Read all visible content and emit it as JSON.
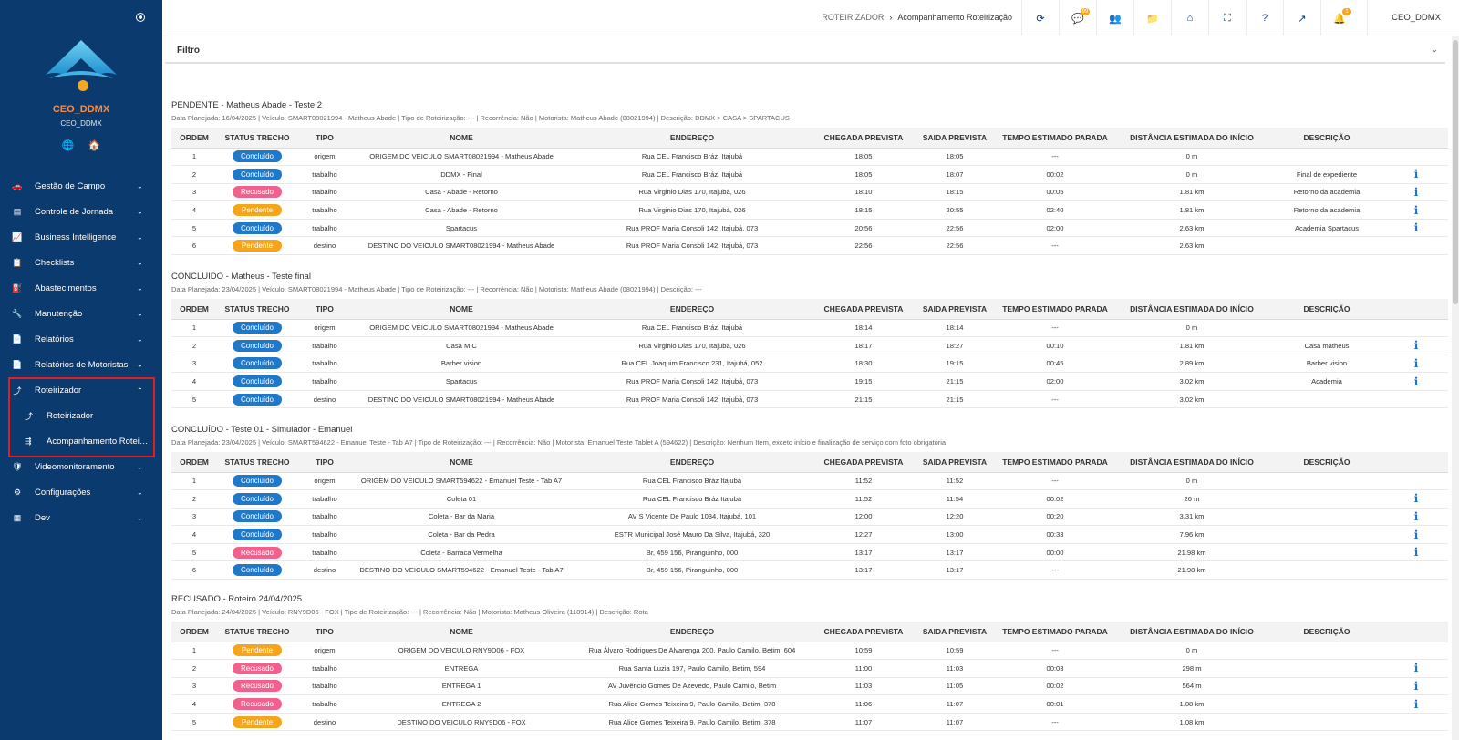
{
  "colors": {
    "sidebar": "#0b3a6e",
    "concluido": "#1f78c8",
    "recusado": "#f2608e",
    "pendente": "#f6a51b",
    "info": "#1a73c8",
    "highlight": "#e02020"
  },
  "sidebar": {
    "user": "CEO_DDMX",
    "user_sub": "CEO_DDMX",
    "items": [
      {
        "icon": "car-icon",
        "glyph": "🚗",
        "label": "Gestão de Campo"
      },
      {
        "icon": "clock-card-icon",
        "glyph": "▤",
        "label": "Controle de Jornada"
      },
      {
        "icon": "chart-line-icon",
        "glyph": "📈",
        "label": "Business Intelligence"
      },
      {
        "icon": "clipboard-icon",
        "glyph": "📋",
        "label": "Checklists"
      },
      {
        "icon": "fuel-icon",
        "glyph": "⛽",
        "label": "Abastecimentos"
      },
      {
        "icon": "wrench-icon",
        "glyph": "🔧",
        "label": "Manutenção"
      },
      {
        "icon": "file-icon",
        "glyph": "📄",
        "label": "Relatórios"
      },
      {
        "icon": "file-icon",
        "glyph": "📄",
        "label": "Relatórios de Motoristas"
      },
      {
        "icon": "route-icon",
        "glyph": "⤴",
        "label": "Roteirizador"
      }
    ],
    "subitems": [
      {
        "icon": "route-icon",
        "glyph": "⤴",
        "label": "Roteirizador"
      },
      {
        "icon": "route-split-icon",
        "glyph": "⇶",
        "label": "Acompanhamento Roteirização"
      }
    ],
    "items_after": [
      {
        "icon": "shield-icon",
        "glyph": "🛡",
        "label": "Videomonitoramento"
      },
      {
        "icon": "gears-icon",
        "glyph": "⚙",
        "label": "Configurações"
      },
      {
        "icon": "dev-icon",
        "glyph": "▦",
        "label": "Dev"
      }
    ]
  },
  "topbar": {
    "breadcrumb_root": "ROTEIRIZADOR",
    "breadcrumb_current": "Acompanhamento Roteirização",
    "buttons": [
      {
        "icon": "refresh-icon",
        "glyph": "⟳",
        "badge": ""
      },
      {
        "icon": "chat-icon",
        "glyph": "💬",
        "badge": "99"
      },
      {
        "icon": "users-icon",
        "glyph": "👥",
        "badge": ""
      },
      {
        "icon": "folder-icon",
        "glyph": "📁",
        "badge": ""
      },
      {
        "icon": "home-icon",
        "glyph": "⌂",
        "badge": ""
      },
      {
        "icon": "fullscreen-icon",
        "glyph": "⛶",
        "badge": ""
      },
      {
        "icon": "help-icon",
        "glyph": "?",
        "badge": ""
      },
      {
        "icon": "external-link-icon",
        "glyph": "↗",
        "badge": ""
      },
      {
        "icon": "bell-icon",
        "glyph": "🔔",
        "badge": "1"
      }
    ],
    "user": "CEO_DDMX"
  },
  "filter": {
    "title": "Filtro"
  },
  "sections": [
    {
      "title": "PENDENTE - Matheus Abade - Teste 2",
      "meta": "Data Planejada: 16/04/2025 | Veículo: SMART08021994 - Matheus Abade | Tipo de Roteirização: --- | Recorrência: Não | Motorista: Matheus Abade (08021994) | Descrição: DDMX > CASA > SPARTACUS",
      "headers": [
        "ORDEM",
        "STATUS TRECHO",
        "TIPO",
        "NOME",
        "ENDEREÇO",
        "CHEGADA PREVISTA",
        "SAIDA PREVISTA",
        "TEMPO ESTIMADO PARADA",
        "DISTÂNCIA ESTIMADA DO INÍCIO",
        "DESCRIÇÃO",
        ""
      ],
      "rows": [
        [
          "1",
          "Concluído",
          "origem",
          "ORIGEM DO VEICULO SMART08021994 - Matheus Abade",
          "Rua CEL Francisco Bráz, Itajubá",
          "18:05",
          "18:05",
          "---",
          "0 m",
          "",
          ""
        ],
        [
          "2",
          "Concluído",
          "trabalho",
          "DDMX - Final",
          "Rua CEL Francisco Bráz, Itajubá",
          "18:05",
          "18:07",
          "00:02",
          "0 m",
          "Final de expediente",
          "i"
        ],
        [
          "3",
          "Recusado",
          "trabalho",
          "Casa - Abade - Retorno",
          "Rua Virginio Dias 170, Itajubá, 026",
          "18:10",
          "18:15",
          "00:05",
          "1.81 km",
          "Retorno da academia",
          "i"
        ],
        [
          "4",
          "Pendente",
          "trabalho",
          "Casa - Abade - Retorno",
          "Rua Virginio Dias 170, Itajubá, 026",
          "18:15",
          "20:55",
          "02:40",
          "1.81 km",
          "Retorno da academia",
          "i"
        ],
        [
          "5",
          "Concluído",
          "trabalho",
          "Spartacus",
          "Rua PROF Maria Consoli 142, Itajubá, 073",
          "20:56",
          "22:56",
          "02:00",
          "2.63 km",
          "Academia Spartacus",
          "i"
        ],
        [
          "6",
          "Pendente",
          "destino",
          "DESTINO DO VEICULO SMART08021994 - Matheus Abade",
          "Rua PROF Maria Consoli 142, Itajubá, 073",
          "22:56",
          "22:56",
          "---",
          "2.63 km",
          "",
          ""
        ]
      ]
    },
    {
      "title": "CONCLUÍDO - Matheus - Teste final",
      "meta": "Data Planejada: 23/04/2025 | Veículo: SMART08021994 - Matheus Abade | Tipo de Roteirização: --- | Recorrência: Não | Motorista: Matheus Abade (08021994) | Descrição: ---",
      "headers": [
        "ORDEM",
        "STATUS TRECHO",
        "TIPO",
        "NOME",
        "ENDEREÇO",
        "CHEGADA PREVISTA",
        "SAIDA PREVISTA",
        "TEMPO ESTIMADO PARADA",
        "DISTÂNCIA ESTIMADA DO INÍCIO",
        "DESCRIÇÃO",
        ""
      ],
      "rows": [
        [
          "1",
          "Concluído",
          "origem",
          "ORIGEM DO VEICULO SMART08021994 - Matheus Abade",
          "Rua CEL Francisco Bráz, Itajubá",
          "18:14",
          "18:14",
          "---",
          "0 m",
          "",
          ""
        ],
        [
          "2",
          "Concluído",
          "trabalho",
          "Casa M.C",
          "Rua Virginio Dias 170, Itajubá, 026",
          "18:17",
          "18:27",
          "00:10",
          "1.81 km",
          "Casa matheus",
          "i"
        ],
        [
          "3",
          "Concluído",
          "trabalho",
          "Barber vision",
          "Rua CEL Joaquim Francisco 231, Itajubá, 052",
          "18:30",
          "19:15",
          "00:45",
          "2.89 km",
          "Barber vision",
          "i"
        ],
        [
          "4",
          "Concluído",
          "trabalho",
          "Spartacus",
          "Rua PROF Maria Consoli 142, Itajubá, 073",
          "19:15",
          "21:15",
          "02:00",
          "3.02 km",
          "Academia",
          "i"
        ],
        [
          "5",
          "Concluído",
          "destino",
          "DESTINO DO VEICULO SMART08021994 - Matheus Abade",
          "Rua PROF Maria Consoli 142, Itajubá, 073",
          "21:15",
          "21:15",
          "---",
          "3.02 km",
          "",
          ""
        ]
      ]
    },
    {
      "title": "CONCLUÍDO - Teste 01 - Simulador - Emanuel",
      "meta": "Data Planejada: 23/04/2025 | Veículo: SMART594622 - Emanuel Teste - Tab A7 | Tipo de Roteirização: --- | Recorrência: Não | Motorista: Emanuel Teste Tablet A (594622) | Descrição: Nenhum Item, exceto início e finalização de serviço com foto obrigatória",
      "headers": [
        "ORDEM",
        "STATUS TRECHO",
        "TIPO",
        "NOME",
        "ENDEREÇO",
        "CHEGADA PREVISTA",
        "SAIDA PREVISTA",
        "TEMPO ESTIMADO PARADA",
        "DISTÂNCIA ESTIMADA DO INÍCIO",
        "DESCRIÇÃO",
        ""
      ],
      "rows": [
        [
          "1",
          "Concluído",
          "origem",
          "ORIGEM DO VEICULO SMART594622 - Emanuel Teste - Tab A7",
          "Rua CEL Francisco Bráz Itajubá",
          "11:52",
          "11:52",
          "---",
          "0 m",
          "",
          ""
        ],
        [
          "2",
          "Concluído",
          "trabalho",
          "Coleta 01",
          "Rua CEL Francisco Bráz Itajubá",
          "11:52",
          "11:54",
          "00:02",
          "26 m",
          "",
          "i"
        ],
        [
          "3",
          "Concluído",
          "trabalho",
          "Coleta - Bar da Maria",
          "AV S Vicente De Paulo 1034, Itajubá, 101",
          "12:00",
          "12:20",
          "00:20",
          "3.31 km",
          "",
          "i"
        ],
        [
          "4",
          "Concluído",
          "trabalho",
          "Coleta - Bar da Pedra",
          "ESTR Municipal José Mauro Da Silva, Itajubá, 320",
          "12:27",
          "13:00",
          "00:33",
          "7.96 km",
          "",
          "i"
        ],
        [
          "5",
          "Recusado",
          "trabalho",
          "Coleta - Barraca Vermelha",
          "Br, 459 156, Piranguinho, 000",
          "13:17",
          "13:17",
          "00:00",
          "21.98 km",
          "",
          "i"
        ],
        [
          "6",
          "Concluído",
          "destino",
          "DESTINO DO VEICULO SMART594622 - Emanuel Teste - Tab A7",
          "Br, 459 156, Piranguinho, 000",
          "13:17",
          "13:17",
          "---",
          "21.98 km",
          "",
          ""
        ]
      ]
    },
    {
      "title": "RECUSADO - Roteiro 24/04/2025",
      "meta": "Data Planejada: 24/04/2025 | Veículo: RNY9D06 - FOX | Tipo de Roteirização: --- | Recorrência: Não | Motorista: Matheus Oliveira (118914) | Descrição: Rota",
      "headers": [
        "ORDEM",
        "STATUS TRECHO",
        "TIPO",
        "NOME",
        "ENDEREÇO",
        "CHEGADA PREVISTA",
        "SAIDA PREVISTA",
        "TEMPO ESTIMADO PARADA",
        "DISTÂNCIA ESTIMADA DO INÍCIO",
        "DESCRIÇÃO",
        ""
      ],
      "rows": [
        [
          "1",
          "Pendente",
          "origem",
          "ORIGEM DO VEICULO RNY9D06 - FOX",
          "Rua Álvaro Rodrigues De Alvarenga 200, Paulo Camilo, Betim, 604",
          "10:59",
          "10:59",
          "---",
          "0 m",
          "",
          ""
        ],
        [
          "2",
          "Recusado",
          "trabalho",
          "ENTREGA",
          "Rua Santa Luzia 197, Paulo Camilo, Betim, 594",
          "11:00",
          "11:03",
          "00:03",
          "298 m",
          "",
          "i"
        ],
        [
          "3",
          "Recusado",
          "trabalho",
          "ENTREGA 1",
          "AV Juvêncio Gomes De Azevedo, Paulo Camilo, Betim",
          "11:03",
          "11:05",
          "00:02",
          "564 m",
          "",
          "i"
        ],
        [
          "4",
          "Recusado",
          "trabalho",
          "ENTREGA 2",
          "Rua Alice Gomes Teixeira 9, Paulo Camilo, Betim, 378",
          "11:06",
          "11:07",
          "00:01",
          "1.08 km",
          "",
          "i"
        ],
        [
          "5",
          "Pendente",
          "destino",
          "DESTINO DO VEICULO RNY9D06 - FOX",
          "Rua Alice Gomes Teixeira 9, Paulo Camilo, Betim, 378",
          "11:07",
          "11:07",
          "---",
          "1.08 km",
          "",
          ""
        ]
      ]
    }
  ]
}
